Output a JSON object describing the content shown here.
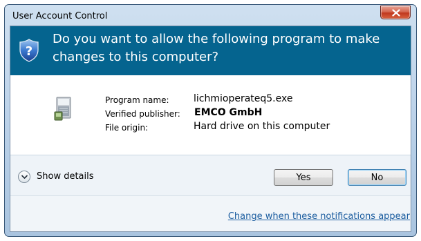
{
  "window": {
    "title": "User Account Control",
    "close_icon": "close-icon"
  },
  "banner": {
    "icon": "shield-question-icon",
    "question": "Do you want to allow the following program to make changes to this computer?",
    "color": "#05648f"
  },
  "program": {
    "icon": "program-installer-icon",
    "rows": [
      {
        "label": "Program name:",
        "value": "lichmioperateq5.exe"
      },
      {
        "label": "Verified publisher:",
        "value": "EMCO GmbH"
      },
      {
        "label": "File origin:",
        "value": "Hard drive on this computer"
      }
    ]
  },
  "actions": {
    "show_details": "Show details",
    "chevron_icon": "chevron-down-icon",
    "yes": "Yes",
    "no": "No"
  },
  "footer": {
    "link": "Change when these notifications appear"
  }
}
